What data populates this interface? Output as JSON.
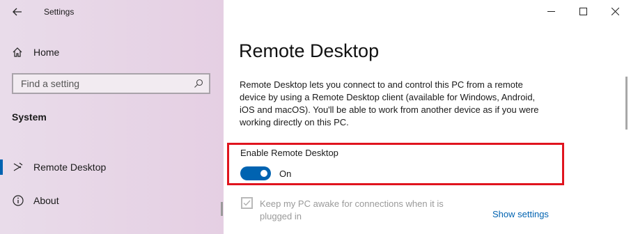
{
  "app": {
    "title": "Settings"
  },
  "sidebar": {
    "home_label": "Home",
    "search_placeholder": "Find a setting",
    "section_title": "System",
    "items": [
      {
        "label": "Remote Desktop",
        "icon": "remote-desktop-icon",
        "selected": true
      },
      {
        "label": "About",
        "icon": "info-icon",
        "selected": false
      }
    ]
  },
  "main": {
    "page_title": "Remote Desktop",
    "description": "Remote Desktop lets you connect to and control this PC from a remote device by using a Remote Desktop client (available for Windows, Android, iOS and macOS). You'll be able to work from another device as if you were working directly on this PC.",
    "toggle": {
      "label": "Enable Remote Desktop",
      "state_label": "On",
      "on": true
    },
    "checkbox": {
      "label": "Keep my PC awake for connections when it is plugged in",
      "checked": true,
      "disabled": true
    },
    "show_settings_link": "Show settings"
  },
  "colors": {
    "accent": "#0063b1",
    "highlight_border": "#e0141e",
    "sidebar_bg": "#e7d5e6"
  }
}
